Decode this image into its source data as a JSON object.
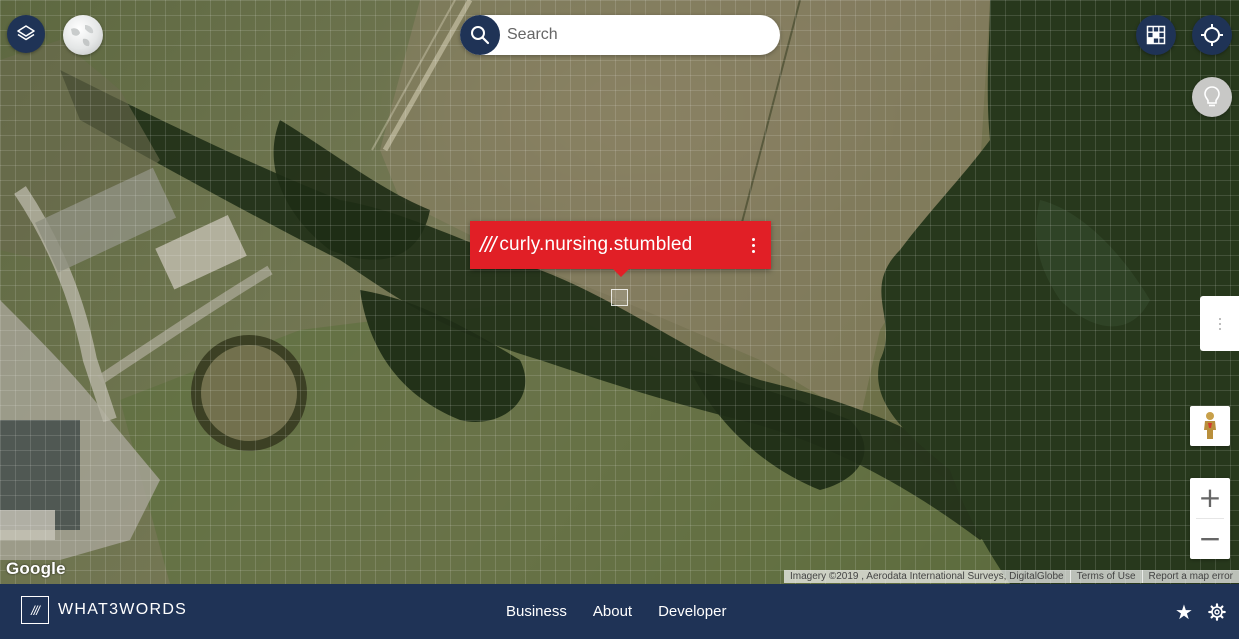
{
  "search": {
    "placeholder": "Search"
  },
  "popup": {
    "slashes": "///",
    "address": "curly.nursing.stumbled"
  },
  "map": {
    "attribution_imagery": "Imagery ©2019 , Aerodata International Surveys, DigitalGlobe",
    "attribution_terms": "Terms of Use",
    "attribution_report": "Report a map error",
    "provider_logo": "Google"
  },
  "footer": {
    "brand_mark": "///",
    "brand_name": "WHAT3WORDS",
    "nav": [
      "Business",
      "About",
      "Developer"
    ]
  },
  "icons": {
    "layers": "layers-icon",
    "globe": "globe-icon",
    "search": "search-icon",
    "grid": "grid-icon",
    "locate": "crosshair-icon",
    "bulb": "lightbulb-icon",
    "pegman": "pegman-icon",
    "star": "star-icon",
    "gear": "gear-icon"
  },
  "colors": {
    "brand_navy": "#1f3356",
    "w3w_red": "#e11f26"
  }
}
